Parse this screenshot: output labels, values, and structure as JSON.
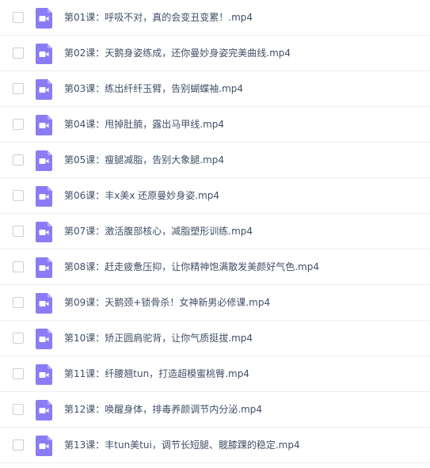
{
  "colors": {
    "icon_fill": "#8a7cf5",
    "icon_fold": "#b5abfa",
    "row_border": "#eeeeee",
    "text": "#424e67"
  },
  "files": [
    {
      "name": "第01课：呼吸不对，真的会变丑变累！.mp4",
      "icon": "video-file-icon"
    },
    {
      "name": "第02课：天鹅身姿练成，还你曼妙身姿完美曲线.mp4",
      "icon": "video-file-icon"
    },
    {
      "name": "第03课：练出纤纤玉臂，告别蝴蝶袖.mp4",
      "icon": "video-file-icon"
    },
    {
      "name": "第04课：甩掉肚腩，露出马甲线.mp4",
      "icon": "video-file-icon"
    },
    {
      "name": "第05课：瘦腿减脂，告别大象腿.mp4",
      "icon": "video-file-icon"
    },
    {
      "name": "第06课：丰x美x 还原曼妙身姿.mp4",
      "icon": "video-file-icon"
    },
    {
      "name": "第07课：激活腹部核心，减脂塑形训练.mp4",
      "icon": "video-file-icon"
    },
    {
      "name": "第08课：赶走疲惫压抑，让你精神饱满散发美颜好气色.mp4",
      "icon": "video-file-icon"
    },
    {
      "name": "第09课：天鹅颈+锁骨杀！女神新男必修课.mp4",
      "icon": "video-file-icon"
    },
    {
      "name": "第10课：矫正圆肩驼背，让你气质挺拔.mp4",
      "icon": "video-file-icon"
    },
    {
      "name": "第11课：纤腰翘tun，打造超模蜜桃臀.mp4",
      "icon": "video-file-icon"
    },
    {
      "name": "第12课：唤醒身体，排毒养颜调节内分泌.mp4",
      "icon": "video-file-icon"
    },
    {
      "name": "第13课：丰tun美tui，调节长短腿、髋膝踝的稳定.mp4",
      "icon": "video-file-icon"
    }
  ]
}
